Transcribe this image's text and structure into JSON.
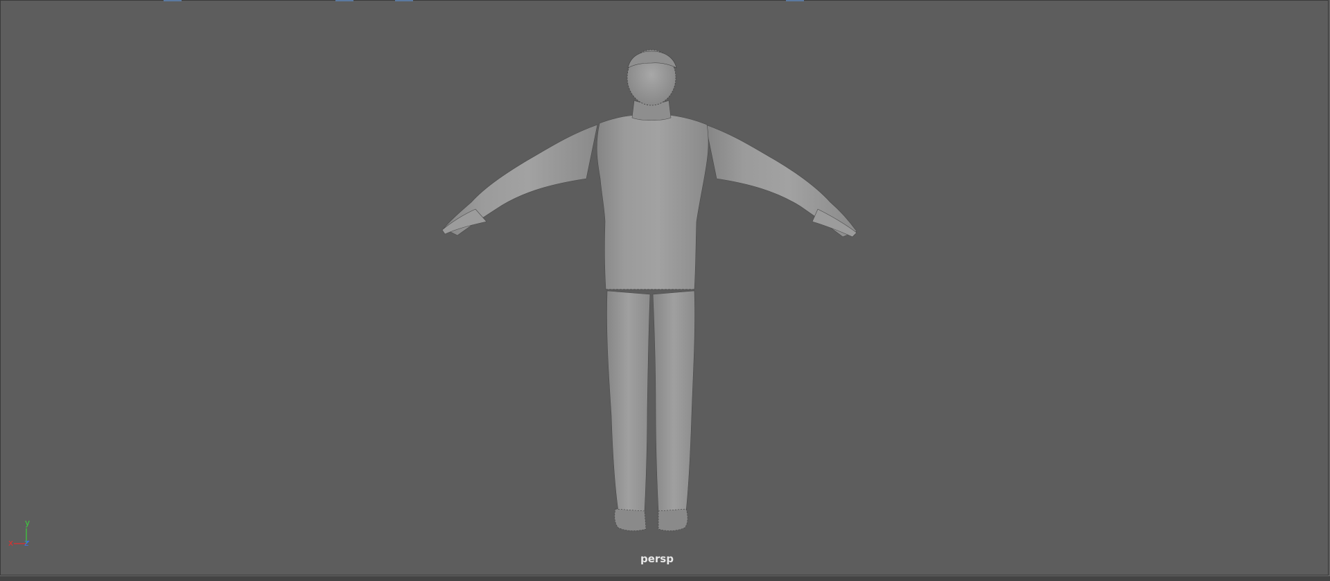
{
  "viewport": {
    "camera_name": "persp",
    "background_color": "#5d5d5d",
    "model_color": "#9a9a9a"
  },
  "axis_indicator": {
    "y_label": "y",
    "x_label": "x",
    "z_label": "z",
    "y_color": "#3cd03c",
    "x_color": "#e03030",
    "z_color": "#3a70e8"
  },
  "top_markers_color": "#5b7aa1"
}
